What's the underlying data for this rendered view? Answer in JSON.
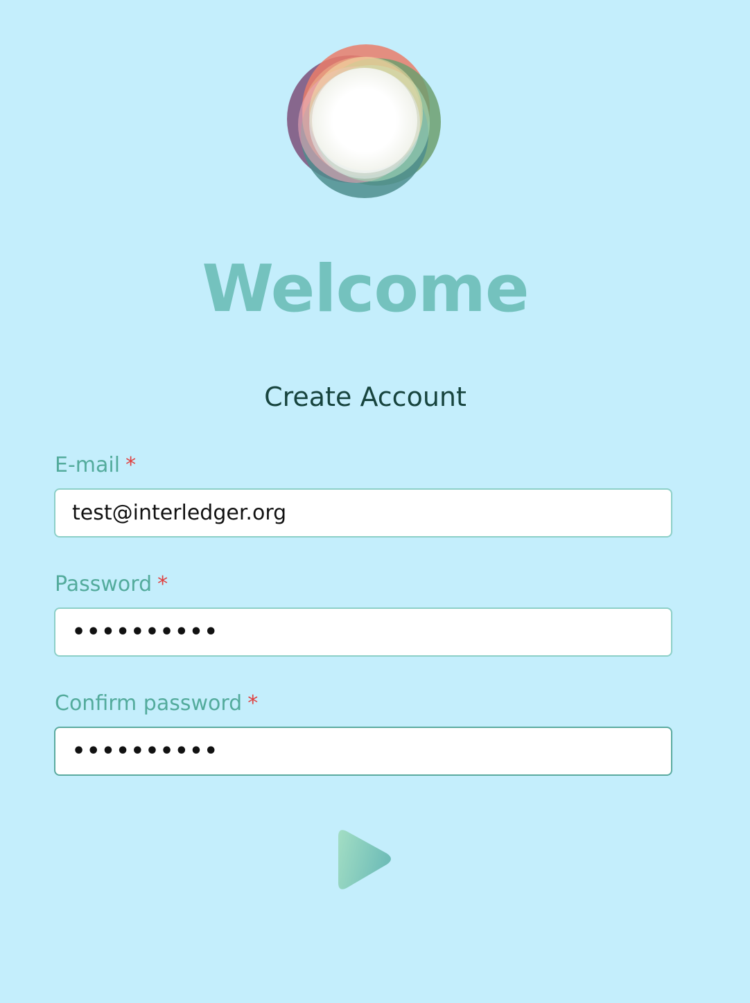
{
  "header": {
    "logo_icon": "multicolor-rings-logo",
    "title": "Welcome",
    "subtitle": "Create Account"
  },
  "form": {
    "email": {
      "label": "E-mail",
      "required_mark": "*",
      "value": "test@interledger.org"
    },
    "password": {
      "label": "Password",
      "required_mark": "*",
      "value": "••••••••••"
    },
    "confirm_password": {
      "label": "Confirm password",
      "required_mark": "*",
      "value": "••••••••••"
    },
    "submit_icon": "play-arrow-icon"
  },
  "colors": {
    "background": "#c4eefc",
    "accent": "#74c2be",
    "label": "#53ab9c",
    "required": "#e0403f",
    "heading": "#17443e"
  }
}
